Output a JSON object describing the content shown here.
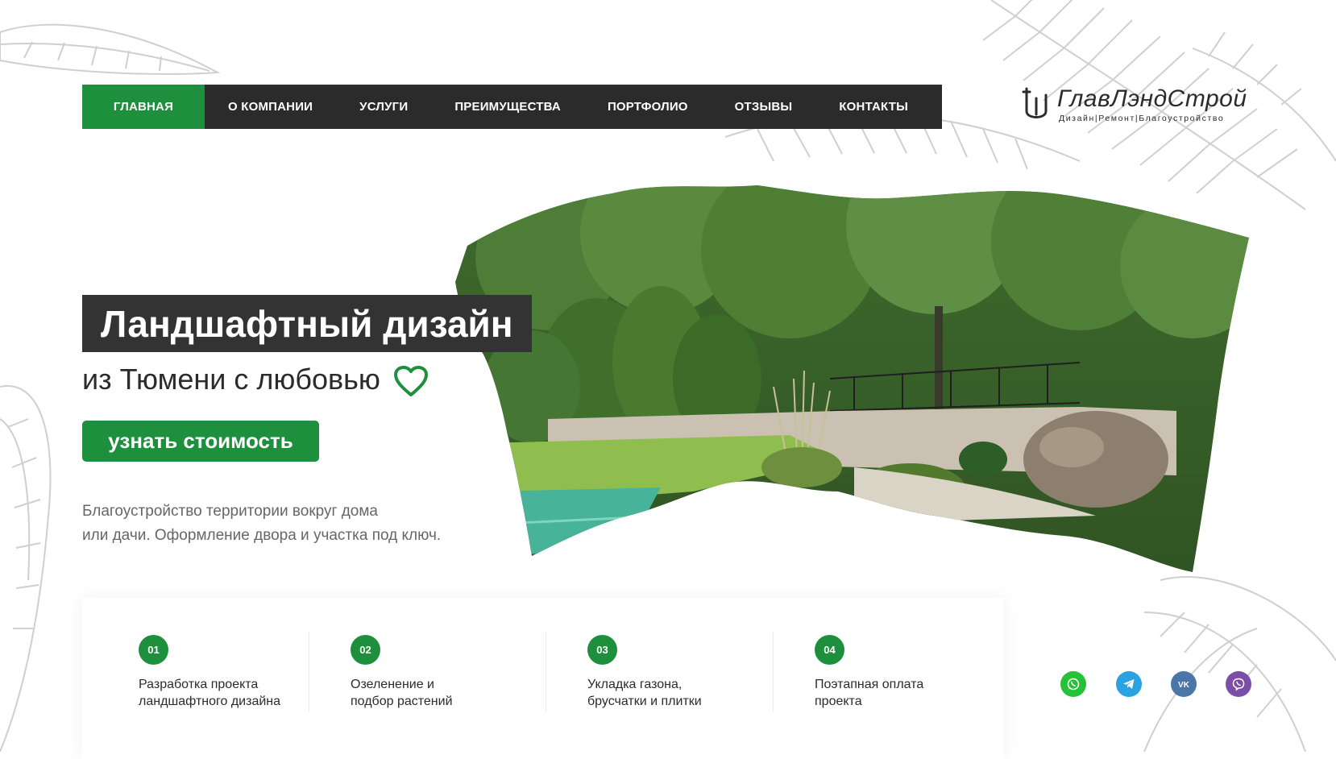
{
  "nav": {
    "items": [
      "ГЛАВНАЯ",
      "О КОМПАНИИ",
      "УСЛУГИ",
      "ПРЕИМУЩЕСТВА",
      "ПОРТФОЛИО",
      "ОТЗЫВЫ",
      "КОНТАКТЫ"
    ],
    "active_index": 0
  },
  "logo": {
    "name": "ГлавЛэндСтрой",
    "tagline": "Дизайн|Ремонт|Благоустройство"
  },
  "hero": {
    "title": "Ландшафтный дизайн",
    "subtitle": "из Тюмени с любовью",
    "cta_label": "узнать стоимость",
    "description_lines": [
      "Благоустройство территории вокруг дома",
      "или дачи. Оформление двора и участка под ключ."
    ]
  },
  "features": [
    {
      "number": "01",
      "lines": [
        "Разработка проекта",
        "ландшафтного дизайна"
      ]
    },
    {
      "number": "02",
      "lines": [
        "Озеленение и",
        "подбор растений"
      ]
    },
    {
      "number": "03",
      "lines": [
        "Укладка газона,",
        "брусчатки и плитки"
      ]
    },
    {
      "number": "04",
      "lines": [
        "Поэтапная оплата",
        "проекта"
      ]
    }
  ],
  "social": [
    {
      "name": "whatsapp-icon",
      "color": "#25c138"
    },
    {
      "name": "telegram-icon",
      "color": "#2aa3e0"
    },
    {
      "name": "vk-icon",
      "color": "#4a76a8"
    },
    {
      "name": "viber-icon",
      "color": "#7d4ea8"
    }
  ],
  "colors": {
    "accent": "#1e8f3d",
    "dark": "#2b2b2b"
  }
}
